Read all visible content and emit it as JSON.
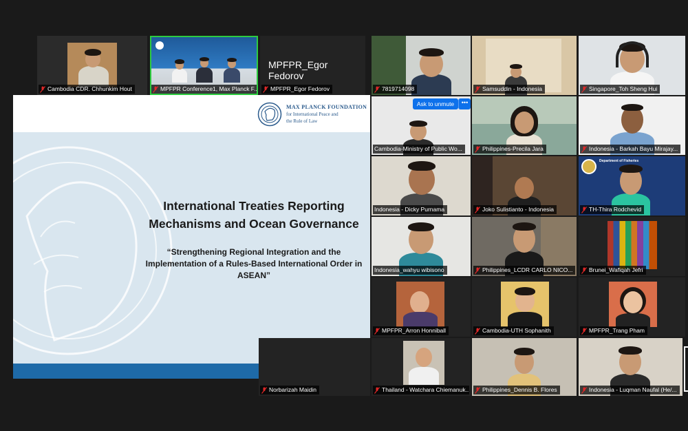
{
  "top_strip": [
    {
      "name": "Cambodia CDR. Chhunkim Hout"
    },
    {
      "name": "MPFPR Conference1, Max Planck F..."
    },
    {
      "name": "MPFPR_Egor Fedorov",
      "display_name": "MPFPR_Egor Fedorov"
    },
    {
      "name": "7819714098"
    },
    {
      "name": "Samsuddin - Indonesia"
    },
    {
      "name": "Singapore_Toh Sheng Hui"
    }
  ],
  "slide": {
    "org_line1": "Max Planck Foundation",
    "org_line2": "for International Peace and",
    "org_line3": "the Rule of Law",
    "title": "International Treaties Reporting Mechanisms and Ocean Governance",
    "subtitle": "“Strengthening Regional Integration and the Implementation of a Rules-Based International Order in ASEAN”"
  },
  "controls": {
    "unmute_label": "Ask to unmute",
    "more_label": "•••"
  },
  "grid": [
    {
      "name": "Cambodia-Ministry of Public Wo..."
    },
    {
      "name": "Philippines-Precila Jara"
    },
    {
      "name": "Indonesia - Barkah Bayu Mirajay..."
    },
    {
      "name": "Indonesia - Dicky Purnama"
    },
    {
      "name": "Joko Sulistianto - Indonesia"
    },
    {
      "name": "TH-Thira Rodchevid",
      "logo_text": "Department of Fisheries"
    },
    {
      "name": "Indonesia_wahyu wibisono"
    },
    {
      "name": "Philippines_LCDR CARLO NICO..."
    },
    {
      "name": "Brunei_Wafiqah Jefri"
    },
    {
      "name": "MPFPR_Arron Honniball"
    },
    {
      "name": "Cambodia-UTH Sophanith"
    },
    {
      "name": "MPFPR_Trang Pham"
    },
    {
      "name": "Thailand - Watchara Chiemanuk..."
    },
    {
      "name": "Philippines_Dennis B. Flores"
    },
    {
      "name": "Indonesia - Luqman Naufal (He/..."
    }
  ],
  "bottom_left": {
    "name": "Norbarizah Maidin"
  },
  "colors": {
    "accent": "#0e71eb",
    "active_speaker": "#2ecc40",
    "muted": "#e02828",
    "slide_footer": "#1e6aa8"
  }
}
